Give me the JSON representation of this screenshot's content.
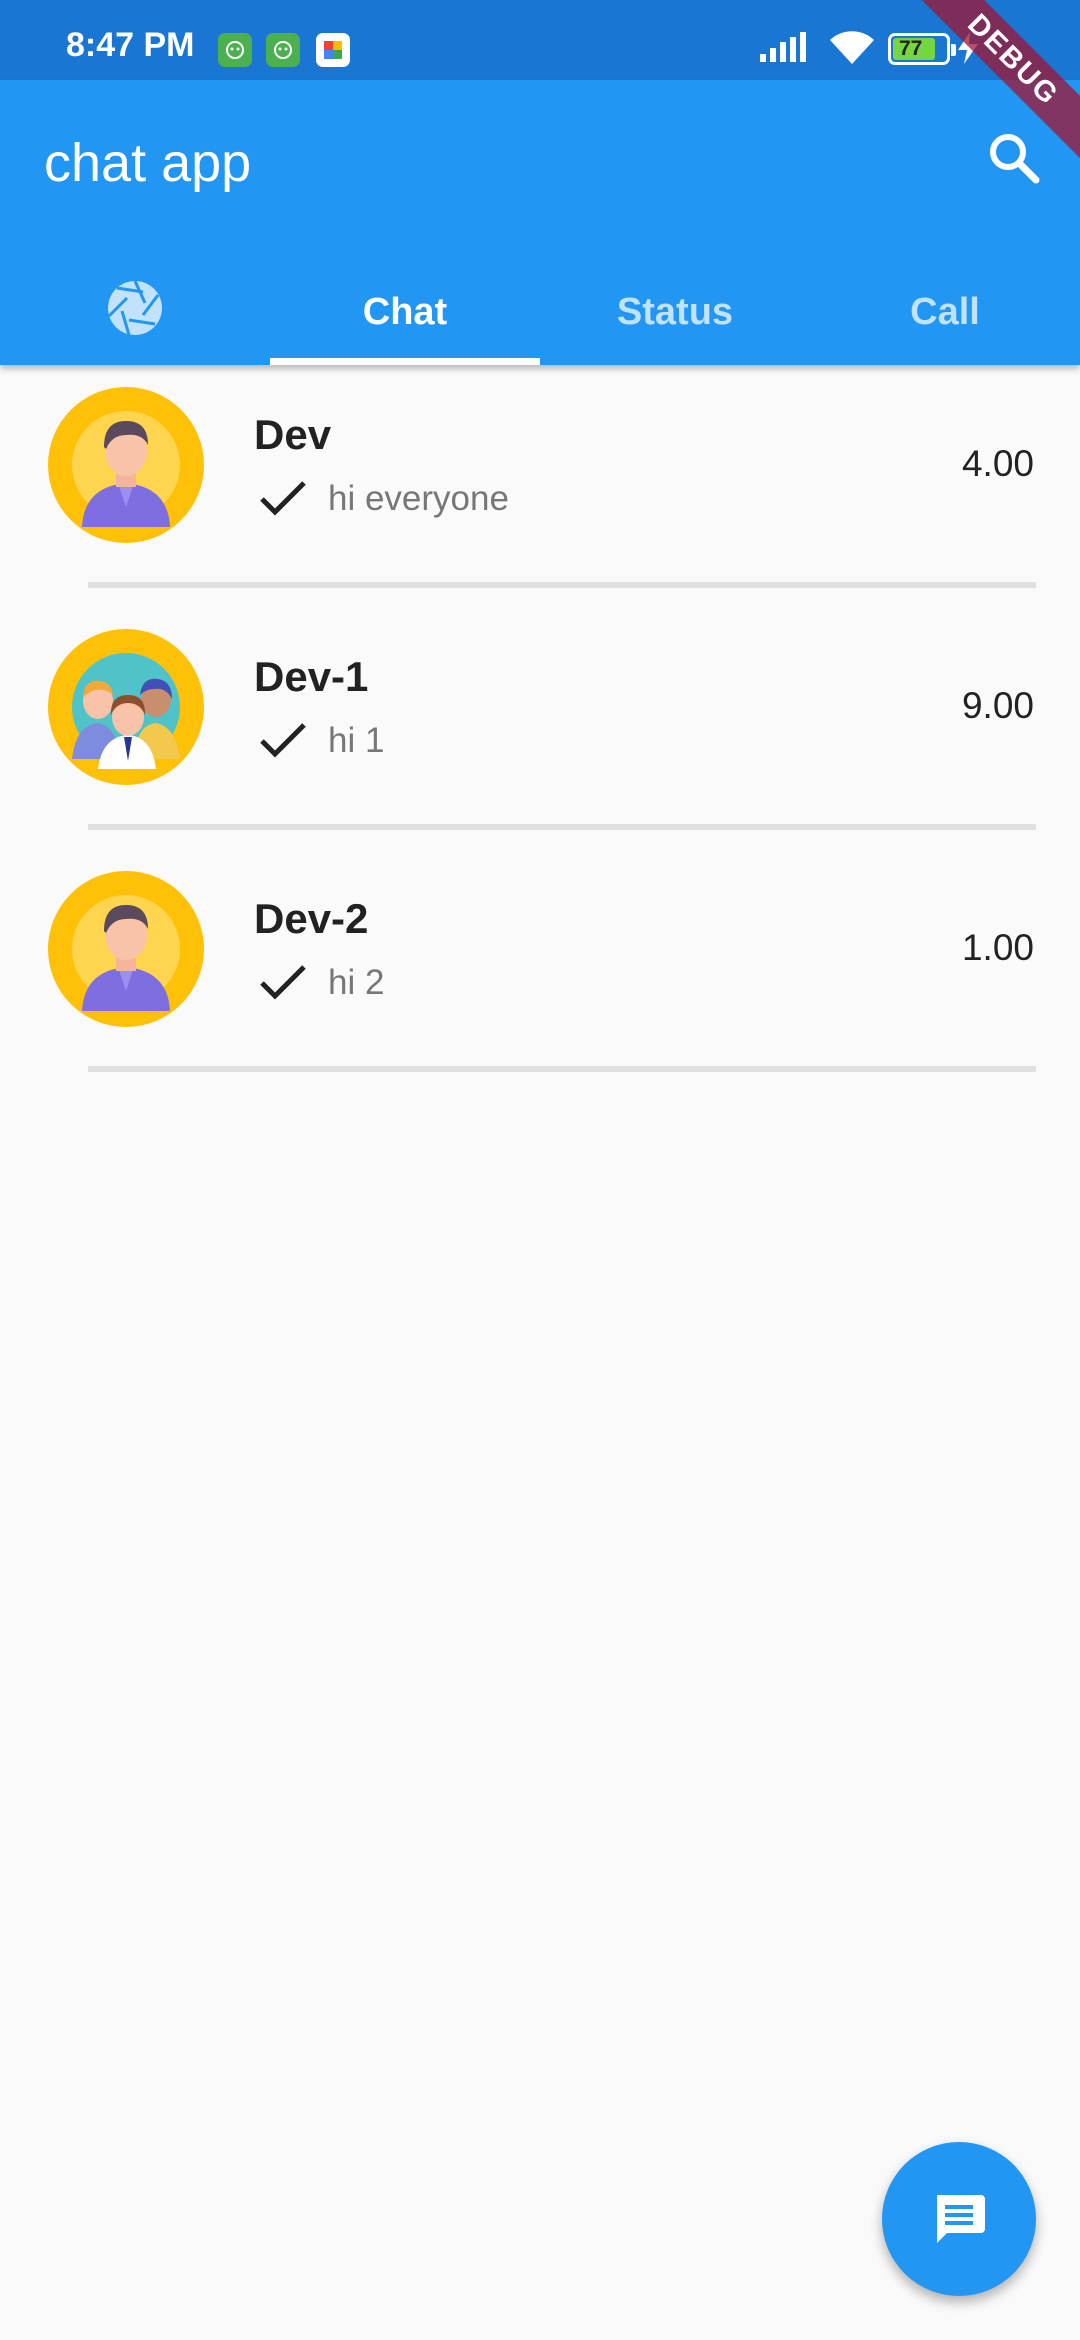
{
  "status_bar": {
    "time": "8:47 PM",
    "notification_icons": [
      "app-notification-icon",
      "app-notification-icon",
      "photos-notification-icon"
    ],
    "battery_level": "77",
    "icons": [
      "signal-icon",
      "wifi-icon",
      "battery-icon",
      "charging-icon"
    ]
  },
  "app_bar": {
    "title": "chat app",
    "search_icon": "search-icon",
    "color": "#2196f3"
  },
  "tabs": {
    "items": [
      {
        "label": "",
        "icon": "camera-icon"
      },
      {
        "label": "Chat"
      },
      {
        "label": "Status"
      },
      {
        "label": "Call"
      }
    ],
    "active_index": 1
  },
  "chats": [
    {
      "name": "Dev",
      "message": "hi everyone",
      "time": "4.00",
      "avatar": "person-avatar"
    },
    {
      "name": "Dev-1",
      "message": "hi 1",
      "time": "9.00",
      "avatar": "group-avatar"
    },
    {
      "name": "Dev-2",
      "message": "hi 2",
      "time": "1.00",
      "avatar": "person-avatar"
    }
  ],
  "fab": {
    "icon": "message-icon"
  },
  "debug_banner": "DEBUG",
  "colors": {
    "primary": "#2196f3",
    "status_bar": "#1976d2",
    "avatar_bg": "#ffc107",
    "background": "#fafafa"
  }
}
